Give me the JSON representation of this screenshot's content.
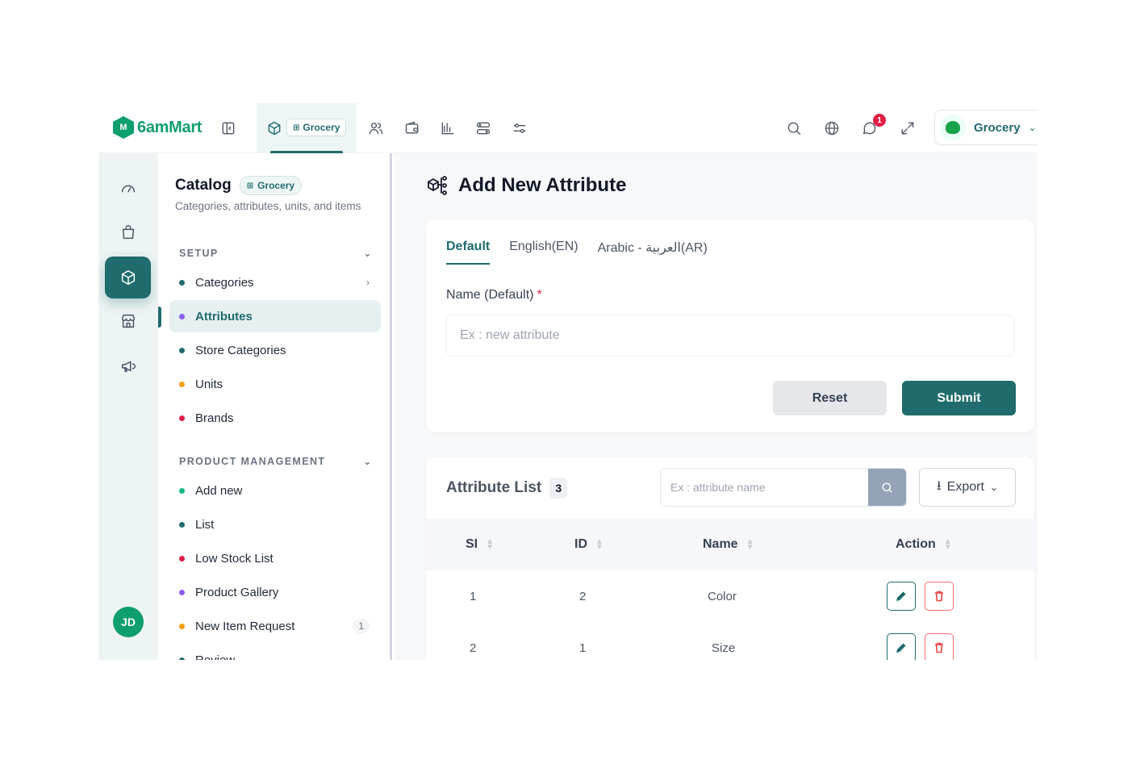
{
  "brand": {
    "name": "6amMart",
    "mark": "M"
  },
  "topbar": {
    "module_chip": "Grocery",
    "notification_count": "1",
    "store": {
      "name": "Grocery"
    }
  },
  "rail": {
    "avatar_initials": "JD"
  },
  "sidebar": {
    "title": "Catalog",
    "chip": "Grocery",
    "subtitle": "Categories, attributes, units, and items",
    "sections": [
      {
        "label": "SETUP",
        "items": [
          {
            "label": "Categories",
            "dot": "#1f6b6d"
          },
          {
            "label": "Attributes",
            "dot": "#8b5cf6"
          },
          {
            "label": "Store Categories",
            "dot": "#1f6b6d"
          },
          {
            "label": "Units",
            "dot": "#f59e0b"
          },
          {
            "label": "Brands",
            "dot": "#e11d48"
          }
        ]
      },
      {
        "label": "PRODUCT MANAGEMENT",
        "items": [
          {
            "label": "Add new",
            "dot": "#10b981"
          },
          {
            "label": "List",
            "dot": "#1f6b6d"
          },
          {
            "label": "Low Stock List",
            "dot": "#e11d48"
          },
          {
            "label": "Product Gallery",
            "dot": "#8b5cf6"
          },
          {
            "label": "New Item Request",
            "dot": "#f59e0b",
            "badge": "1"
          },
          {
            "label": "Review",
            "dot": "#1f6b6d"
          }
        ]
      }
    ]
  },
  "page": {
    "title": "Add New Attribute"
  },
  "form": {
    "tabs": [
      "Default",
      "English(EN)",
      "Arabic - العربية(AR)"
    ],
    "name_label": "Name (Default)",
    "required_mark": "*",
    "name_placeholder": "Ex : new attribute",
    "reset_label": "Reset",
    "submit_label": "Submit"
  },
  "list": {
    "title": "Attribute List",
    "count": "3",
    "search_placeholder": "Ex : attribute name",
    "export_label": "Export",
    "columns": [
      "SI",
      "ID",
      "Name",
      "Action"
    ],
    "rows": [
      {
        "si": "1",
        "id": "2",
        "name": "Color"
      },
      {
        "si": "2",
        "id": "1",
        "name": "Size"
      }
    ]
  },
  "colors": {
    "primary": "#1f6b6d",
    "brand": "#0e9f6e",
    "danger": "#ef4444"
  }
}
